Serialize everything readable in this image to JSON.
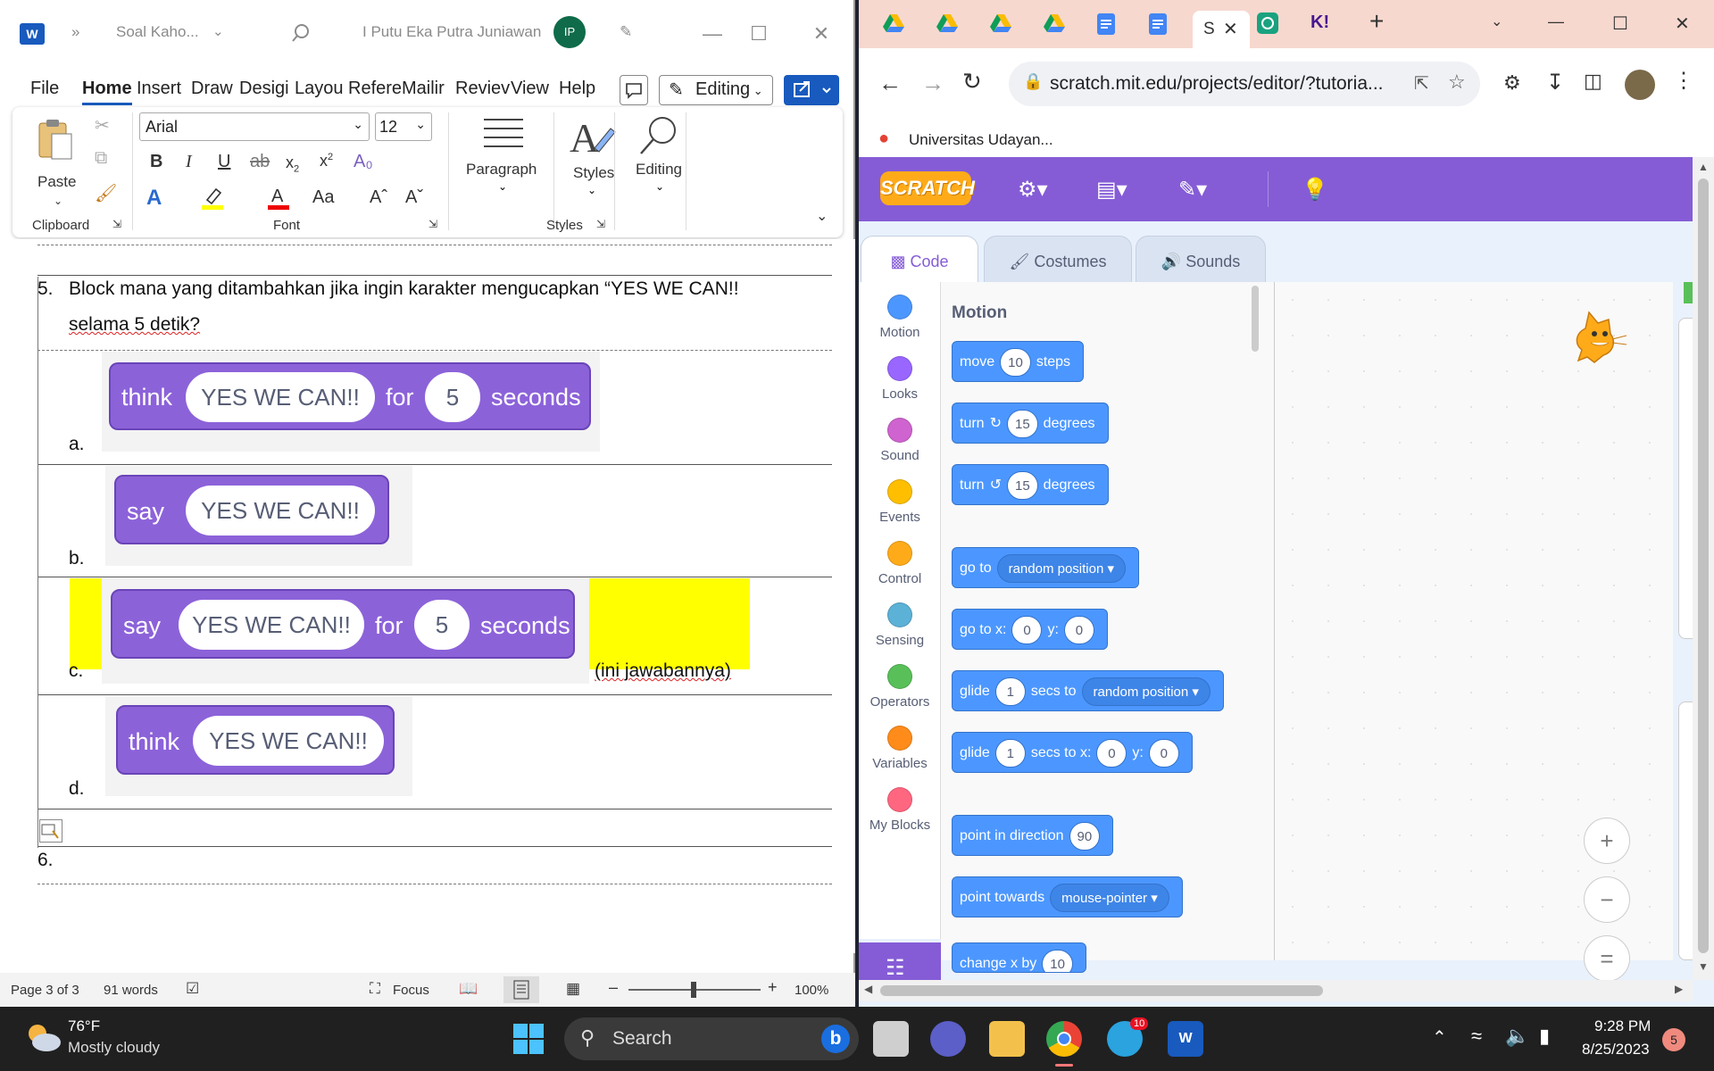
{
  "word": {
    "doc_title": "Soal Kaho...",
    "user_name": "I Putu Eka Putra Juniawan",
    "user_initials": "IP",
    "menu": [
      "File",
      "Home",
      "Insert",
      "Draw",
      "Desigi",
      "Layou",
      "Refere",
      "Mailir",
      "Reviev",
      "View",
      "Help"
    ],
    "editing_label": "Editing",
    "ribbon": {
      "paste_label": "Paste",
      "clipboard_label": "Clipboard",
      "font_label": "Font",
      "font_name": "Arial",
      "font_size": "12",
      "paragraph_label": "Paragraph",
      "styles_label": "Styles",
      "styles_group_label": "Styles",
      "editing_label": "Editing"
    },
    "question": {
      "number": "5.",
      "line1": "Block mana yang ditambahkan jika ingin karakter mengucapkan “YES WE CAN!!",
      "line2": "selama 5 detik?"
    },
    "options": [
      {
        "letter": "a.",
        "verb": "think",
        "text": "YES WE CAN!!",
        "for": "for",
        "num": "5",
        "unit": "seconds"
      },
      {
        "letter": "b.",
        "verb": "say",
        "text": "YES WE CAN!!"
      },
      {
        "letter": "c.",
        "verb": "say",
        "text": "YES WE CAN!!",
        "for": "for",
        "num": "5",
        "unit": "seconds",
        "note": "(ini jawabannya)"
      },
      {
        "letter": "d.",
        "verb": "think",
        "text": "YES WE CAN!!"
      }
    ],
    "next_number": "6.",
    "status": {
      "page": "Page 3 of 3",
      "words": "91 words",
      "focus": "Focus",
      "zoom": "100%"
    },
    "highlight_color": "#ffff00"
  },
  "chrome": {
    "url": "scratch.mit.edu/projects/editor/?tutoria...",
    "bookmark": "Universitas Udayan...",
    "active_tab_title": "S",
    "tab_k_label": "K!"
  },
  "scratch": {
    "logo": "SCRATCH",
    "tabs": [
      "Code",
      "Costumes",
      "Sounds"
    ],
    "categories": [
      {
        "name": "Motion",
        "color": "#4c97ff"
      },
      {
        "name": "Looks",
        "color": "#9966ff"
      },
      {
        "name": "Sound",
        "color": "#cf63cf"
      },
      {
        "name": "Events",
        "color": "#ffbf00"
      },
      {
        "name": "Control",
        "color": "#ffab19"
      },
      {
        "name": "Sensing",
        "color": "#5cb1d6"
      },
      {
        "name": "Operators",
        "color": "#59c059"
      },
      {
        "name": "Variables",
        "color": "#ff8c1a"
      },
      {
        "name": "My Blocks",
        "color": "#ff6680"
      }
    ],
    "palette_title": "Motion",
    "blocks": {
      "move": {
        "t1": "move",
        "v": "10",
        "t2": "steps"
      },
      "turn_cw": {
        "t1": "turn",
        "v": "15",
        "t2": "degrees"
      },
      "turn_ccw": {
        "t1": "turn",
        "v": "15",
        "t2": "degrees"
      },
      "goto": {
        "t1": "go to",
        "d": "random position ▾"
      },
      "gotoxy": {
        "t1": "go to x:",
        "x": "0",
        "t2": "y:",
        "y": "0"
      },
      "glide": {
        "t1": "glide",
        "v": "1",
        "t2": "secs to",
        "d": "random position ▾"
      },
      "glidexy": {
        "t1": "glide",
        "v": "1",
        "t2": "secs to x:",
        "x": "0",
        "t3": "y:",
        "y": "0"
      },
      "point_dir": {
        "t1": "point in direction",
        "v": "90"
      },
      "point_towards": {
        "t1": "point towards",
        "d": "mouse-pointer ▾"
      },
      "change_x": {
        "t1": "change x by",
        "v": "10"
      }
    },
    "zoom_in": "+",
    "zoom_out": "−",
    "zoom_reset": "="
  },
  "taskbar": {
    "temp": "76°F",
    "weather": "Mostly cloudy",
    "search": "Search",
    "time": "9:28 PM",
    "date": "8/25/2023",
    "notifications": "5",
    "telegram_badge": "10"
  }
}
